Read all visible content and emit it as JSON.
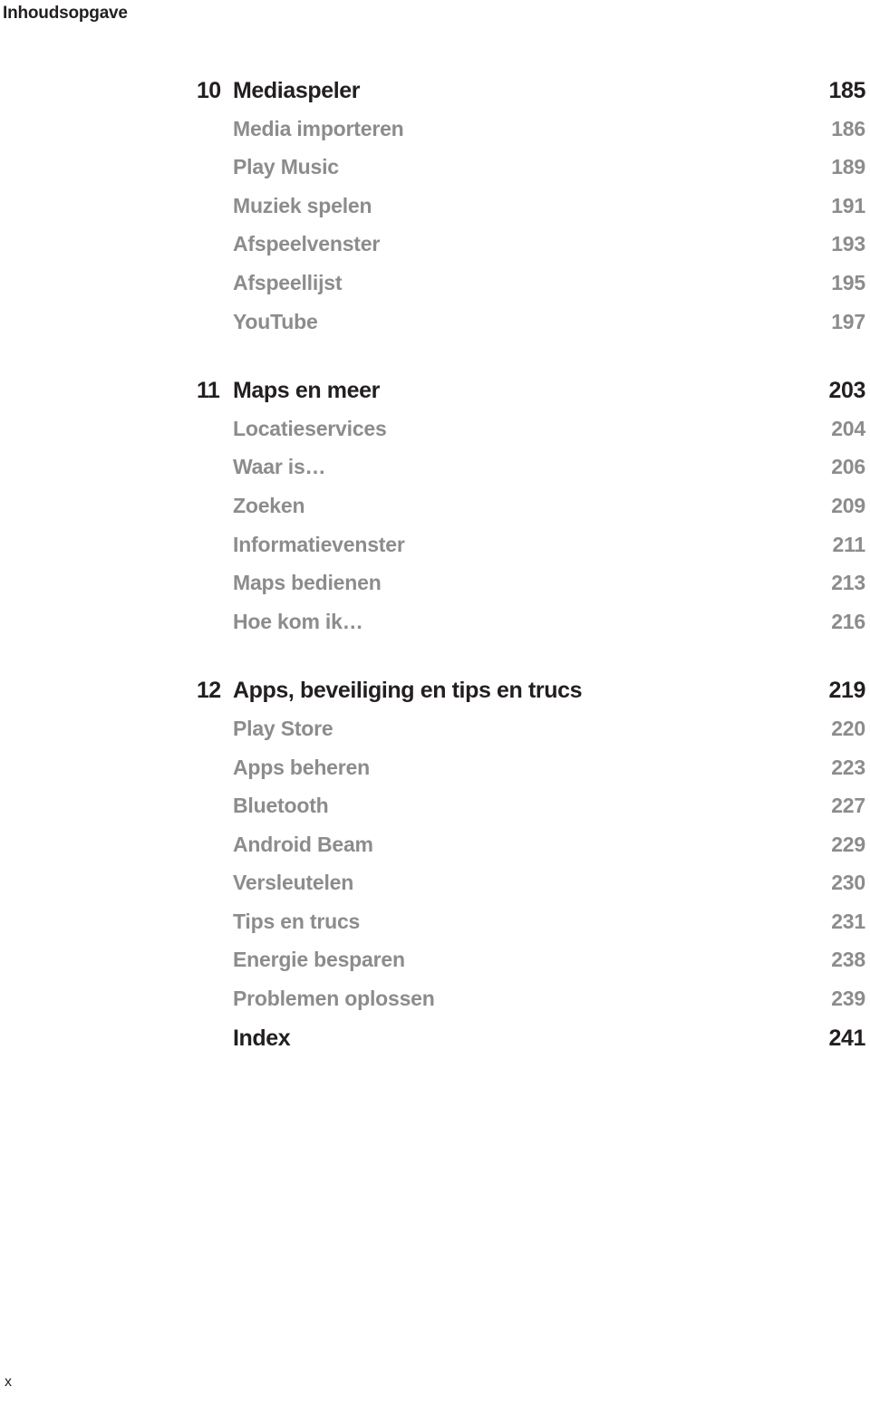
{
  "running_head": "Inhoudsopgave",
  "folio": "x",
  "colors": {
    "text": "#231f20",
    "entry_gray": "#8c8c8c",
    "background": "#ffffff"
  },
  "toc": {
    "rows": [
      {
        "kind": "chapter",
        "number": "10",
        "title": "Mediaspeler",
        "page": "185"
      },
      {
        "kind": "entry",
        "number": "",
        "title": "Media importeren",
        "page": "186"
      },
      {
        "kind": "entry",
        "number": "",
        "title": "Play Music",
        "page": "189"
      },
      {
        "kind": "entry",
        "number": "",
        "title": "Muziek spelen",
        "page": "191"
      },
      {
        "kind": "entry",
        "number": "",
        "title": "Afspeelvenster",
        "page": "193"
      },
      {
        "kind": "entry",
        "number": "",
        "title": "Afspeellijst",
        "page": "195"
      },
      {
        "kind": "entry",
        "number": "",
        "title": "YouTube",
        "page": "197"
      },
      {
        "kind": "chapter",
        "number": "11",
        "title": "Maps en meer",
        "page": "203"
      },
      {
        "kind": "entry",
        "number": "",
        "title": "Locatieservices",
        "page": "204"
      },
      {
        "kind": "entry",
        "number": "",
        "title": "Waar is…",
        "page": "206"
      },
      {
        "kind": "entry",
        "number": "",
        "title": "Zoeken",
        "page": "209"
      },
      {
        "kind": "entry",
        "number": "",
        "title": "Informatievenster",
        "page": "211"
      },
      {
        "kind": "entry",
        "number": "",
        "title": "Maps bedienen",
        "page": "213"
      },
      {
        "kind": "entry",
        "number": "",
        "title": "Hoe kom ik…",
        "page": "216"
      },
      {
        "kind": "chapter",
        "number": "12",
        "title": "Apps, beveiliging en tips en trucs",
        "page": "219"
      },
      {
        "kind": "entry",
        "number": "",
        "title": "Play Store",
        "page": "220"
      },
      {
        "kind": "entry",
        "number": "",
        "title": "Apps beheren",
        "page": "223"
      },
      {
        "kind": "entry",
        "number": "",
        "title": "Bluetooth",
        "page": "227"
      },
      {
        "kind": "entry",
        "number": "",
        "title": "Android Beam",
        "page": "229"
      },
      {
        "kind": "entry",
        "number": "",
        "title": "Versleutelen",
        "page": "230"
      },
      {
        "kind": "entry",
        "number": "",
        "title": "Tips en trucs",
        "page": "231"
      },
      {
        "kind": "entry",
        "number": "",
        "title": "Energie besparen",
        "page": "238"
      },
      {
        "kind": "entry",
        "number": "",
        "title": "Problemen oplossen",
        "page": "239"
      },
      {
        "kind": "index",
        "number": "",
        "title": "Index",
        "page": "241"
      }
    ]
  }
}
